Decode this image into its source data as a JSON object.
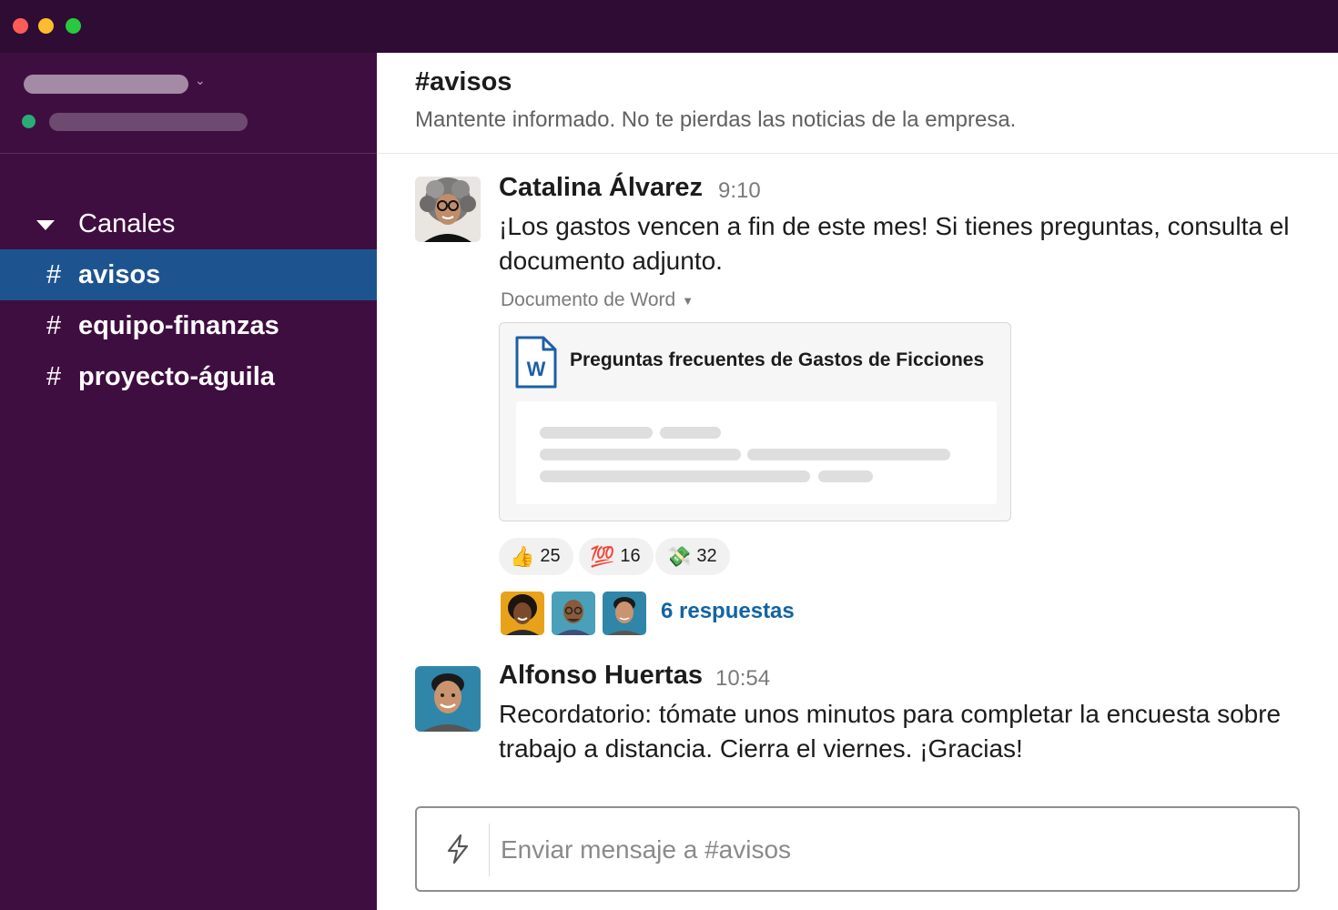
{
  "window": {
    "controls": [
      "close",
      "minimize",
      "maximize"
    ]
  },
  "sidebar": {
    "section_label": "Canales",
    "channels": [
      {
        "hash": "#",
        "name": "avisos",
        "active": true
      },
      {
        "hash": "#",
        "name": "equipo-finanzas",
        "active": false
      },
      {
        "hash": "#",
        "name": "proyecto-águila",
        "active": false
      }
    ]
  },
  "channel": {
    "title": "#avisos",
    "topic": "Mantente informado. No te pierdas las noticias de la empresa."
  },
  "messages": [
    {
      "author": "Catalina Álvarez",
      "time": "9:10",
      "text": "¡Los gastos vencen a fin de este mes! Si tienes preguntas, consulta el documento adjunto.",
      "attachment": {
        "type_label": "Documento de Word",
        "icon_letter": "W",
        "title": "Preguntas frecuentes de Gastos de Ficciones"
      },
      "reactions": [
        {
          "emoji": "👍",
          "count": "25"
        },
        {
          "emoji": "💯",
          "count": "16"
        },
        {
          "emoji": "💸",
          "count": "32"
        }
      ],
      "replies_label": "6 respuestas"
    },
    {
      "author": "Alfonso Huertas",
      "time": "10:54",
      "text": "Recordatorio: tómate unos minutos para completar la encuesta sobre trabajo a distancia. Cierra el viernes. ¡Gracias!"
    }
  ],
  "composer": {
    "placeholder": "Enviar mensaje a #avisos"
  },
  "colors": {
    "titlebar": "#2e0c33",
    "sidebar": "#3f0e40",
    "active_channel": "#1d5490",
    "link": "#1264a3",
    "presence": "#2bac76"
  }
}
